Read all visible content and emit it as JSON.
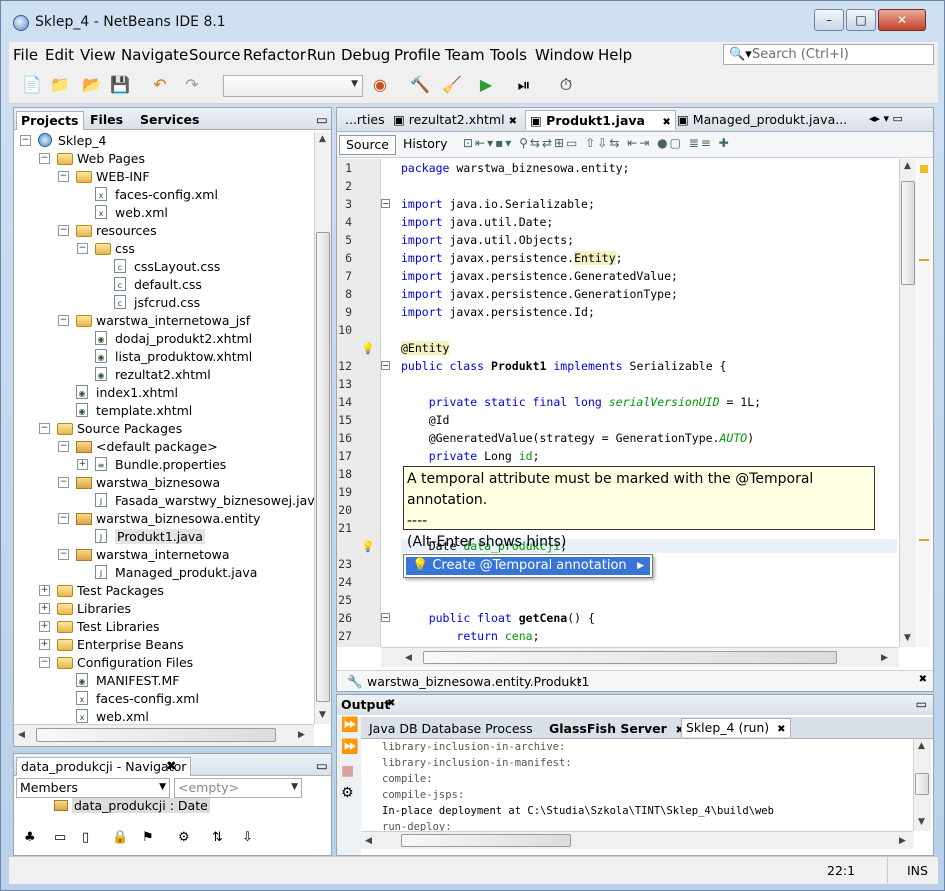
{
  "window": {
    "title": "Sklep_4 - NetBeans IDE 8.1",
    "minimize": "–",
    "maximize": "□",
    "close": "✕"
  },
  "menu": [
    "File",
    "Edit",
    "View",
    "Navigate",
    "Source",
    "Refactor",
    "Run",
    "Debug",
    "Profile",
    "Team",
    "Tools",
    "Window",
    "Help"
  ],
  "search": {
    "placeholder": "Search (Ctrl+I)"
  },
  "projects": {
    "tabs": [
      "Projects",
      "Files",
      "Services"
    ],
    "tree": [
      {
        "label": "Sklep_4",
        "depth": 0,
        "icon": "globe-icon",
        "toggle": "−"
      },
      {
        "label": "Web Pages",
        "depth": 1,
        "icon": "folder-icon",
        "toggle": "−"
      },
      {
        "label": "WEB-INF",
        "depth": 2,
        "icon": "folder-icon",
        "toggle": "−"
      },
      {
        "label": "faces-config.xml",
        "depth": 3,
        "icon": "xml-file-icon",
        "toggle": ""
      },
      {
        "label": "web.xml",
        "depth": 3,
        "icon": "xml-file-icon",
        "toggle": ""
      },
      {
        "label": "resources",
        "depth": 2,
        "icon": "folder-icon",
        "toggle": "−"
      },
      {
        "label": "css",
        "depth": 3,
        "icon": "folder-icon",
        "toggle": "−"
      },
      {
        "label": "cssLayout.css",
        "depth": 4,
        "icon": "css-file-icon",
        "toggle": ""
      },
      {
        "label": "default.css",
        "depth": 4,
        "icon": "css-file-icon",
        "toggle": ""
      },
      {
        "label": "jsfcrud.css",
        "depth": 4,
        "icon": "css-file-icon",
        "toggle": ""
      },
      {
        "label": "warstwa_internetowa_jsf",
        "depth": 2,
        "icon": "folder-icon",
        "toggle": "−"
      },
      {
        "label": "dodaj_produkt2.xhtml",
        "depth": 3,
        "icon": "xhtml-file-icon",
        "toggle": ""
      },
      {
        "label": "lista_produktow.xhtml",
        "depth": 3,
        "icon": "xhtml-file-icon",
        "toggle": ""
      },
      {
        "label": "rezultat2.xhtml",
        "depth": 3,
        "icon": "xhtml-file-icon",
        "toggle": ""
      },
      {
        "label": "index1.xhtml",
        "depth": 2,
        "icon": "xhtml-file-icon",
        "toggle": ""
      },
      {
        "label": "template.xhtml",
        "depth": 2,
        "icon": "xhtml-file-icon",
        "toggle": ""
      },
      {
        "label": "Source Packages",
        "depth": 1,
        "icon": "folder-icon",
        "toggle": "−"
      },
      {
        "label": "<default package>",
        "depth": 2,
        "icon": "package-icon",
        "toggle": "−"
      },
      {
        "label": "Bundle.properties",
        "depth": 3,
        "icon": "properties-file-icon",
        "toggle": "+"
      },
      {
        "label": "warstwa_biznesowa",
        "depth": 2,
        "icon": "package-icon",
        "toggle": "−"
      },
      {
        "label": "Fasada_warstwy_biznesowej.java",
        "depth": 3,
        "icon": "java-file-icon",
        "toggle": ""
      },
      {
        "label": "warstwa_biznesowa.entity",
        "depth": 2,
        "icon": "package-icon",
        "toggle": "−"
      },
      {
        "label": "Produkt1.java",
        "depth": 3,
        "icon": "java-file-icon",
        "toggle": ""
      },
      {
        "label": "warstwa_internetowa",
        "depth": 2,
        "icon": "package-icon",
        "toggle": "−"
      },
      {
        "label": "Managed_produkt.java",
        "depth": 3,
        "icon": "java-file-icon",
        "toggle": ""
      },
      {
        "label": "Test Packages",
        "depth": 1,
        "icon": "folder-icon",
        "toggle": "+"
      },
      {
        "label": "Libraries",
        "depth": 1,
        "icon": "folder-icon",
        "toggle": "+"
      },
      {
        "label": "Test Libraries",
        "depth": 1,
        "icon": "folder-icon",
        "toggle": "+"
      },
      {
        "label": "Enterprise Beans",
        "depth": 1,
        "icon": "folder-icon",
        "toggle": "+"
      },
      {
        "label": "Configuration Files",
        "depth": 1,
        "icon": "folder-icon",
        "toggle": "−"
      },
      {
        "label": "MANIFEST.MF",
        "depth": 2,
        "icon": "manifest-file-icon",
        "toggle": ""
      },
      {
        "label": "faces-config.xml",
        "depth": 2,
        "icon": "xml-file-icon",
        "toggle": ""
      },
      {
        "label": "web.xml",
        "depth": 2,
        "icon": "xml-file-icon",
        "toggle": ""
      }
    ]
  },
  "navigator": {
    "title": "data_produkcji - Navigator",
    "members": "Members",
    "filter": "<empty>",
    "item": "data_produkcji : Date"
  },
  "editor": {
    "tabs": [
      "...rties",
      "rezultat2.xhtml",
      "Produkt1.java",
      "Managed_produkt.java..."
    ],
    "source_label": "Source",
    "history_label": "History",
    "lines": [
      {
        "n": "1",
        "html": "<span class='kw'>package</span> warstwa_biznesowa.entity;"
      },
      {
        "n": "2",
        "html": ""
      },
      {
        "n": "3",
        "html": "<span class='kw'>import</span> java.io.Serializable;"
      },
      {
        "n": "4",
        "html": "<span class='kw'>import</span> java.util.Date;"
      },
      {
        "n": "5",
        "html": "<span class='kw'>import</span> java.util.Objects;"
      },
      {
        "n": "6",
        "html": "<span class='kw'>import</span> javax.persistence.<span class='hl'>Entity</span>;"
      },
      {
        "n": "7",
        "html": "<span class='kw'>import</span> javax.persistence.GeneratedValue;"
      },
      {
        "n": "8",
        "html": "<span class='kw'>import</span> javax.persistence.GenerationType;"
      },
      {
        "n": "9",
        "html": "<span class='kw'>import</span> javax.persistence.Id;"
      },
      {
        "n": "10",
        "html": ""
      },
      {
        "n": "",
        "html": "<span class='hl'>@Entity</span>"
      },
      {
        "n": "12",
        "html": "<span class='kw'>public class</span> <b>Produkt1</b> <span class='kw'>implements</span> Serializable {"
      },
      {
        "n": "13",
        "html": ""
      },
      {
        "n": "14",
        "html": "    <span class='kw'>private static final long</span> <span class='ital'>serialVersionUID</span> = 1L;"
      },
      {
        "n": "15",
        "html": "    @Id"
      },
      {
        "n": "16",
        "html": "    @GeneratedValue(strategy = GenerationType.<i style='color:#009900'>AUTO</i>)"
      },
      {
        "n": "17",
        "html": "    <span class='kw'>private</span> Long <span class='fld'>id</span>;"
      },
      {
        "n": "18",
        "html": ""
      },
      {
        "n": "19",
        "html": ""
      },
      {
        "n": "20",
        "html": ""
      },
      {
        "n": "21",
        "html": ""
      },
      {
        "n": "",
        "html": "    Date <span class='fld'>data_produkcji</span>;"
      },
      {
        "n": "23",
        "html": ""
      },
      {
        "n": "24",
        "html": ""
      },
      {
        "n": "25",
        "html": ""
      },
      {
        "n": "26",
        "html": "    <span class='kw'>public float</span> <b>getCena</b>() {"
      },
      {
        "n": "27",
        "html": "        <span class='kw'>return</span> <span class='fld'>cena</span>;"
      }
    ],
    "tooltip": [
      "A temporal attribute must be marked with the @Temporal annotation.",
      "----",
      "(Alt-Enter shows hints)"
    ],
    "hint": "Create @Temporal annotation",
    "breadcrumb": "warstwa_biznesowa.entity.Produkt1"
  },
  "output": {
    "title": "Output",
    "tabs": [
      "Java DB Database Process",
      "GlassFish Server",
      "Sklep_4 (run)"
    ],
    "lines": [
      "library-inclusion-in-archive:",
      "library-inclusion-in-manifest:",
      "compile:",
      "compile-jsps:",
      "In-place deployment at C:\\Studia\\Szkola\\TINT\\Sklep_4\\build\\web",
      "run-deploy:"
    ]
  },
  "status": {
    "position": "22:1",
    "mode": "INS"
  }
}
